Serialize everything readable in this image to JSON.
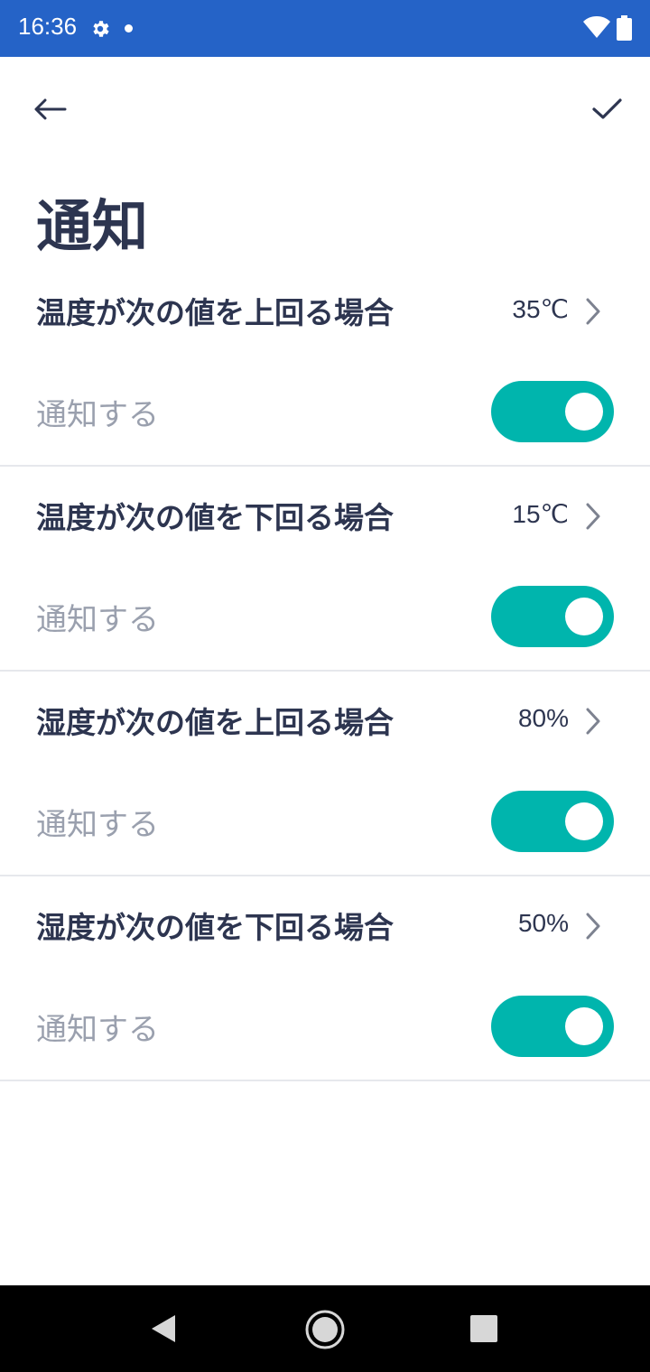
{
  "status_bar": {
    "time": "16:36",
    "icons": [
      "gear-icon",
      "dot-icon",
      "wifi-icon",
      "battery-icon"
    ]
  },
  "app_bar": {
    "back_icon": "arrow-left-icon",
    "save_icon": "check-icon"
  },
  "title": "通知",
  "settings": [
    {
      "label": "温度が次の値を上回る場合",
      "value": "35℃",
      "toggle_label": "通知する",
      "enabled": true
    },
    {
      "label": "温度が次の値を下回る場合",
      "value": "15℃",
      "toggle_label": "通知する",
      "enabled": true
    },
    {
      "label": "湿度が次の値を上回る場合",
      "value": "80%",
      "toggle_label": "通知する",
      "enabled": true
    },
    {
      "label": "湿度が次の値を下回る場合",
      "value": "50%",
      "toggle_label": "通知する",
      "enabled": true
    }
  ],
  "nav_bar": {
    "icons": [
      "nav-back-icon",
      "nav-home-icon",
      "nav-recents-icon"
    ]
  },
  "colors": {
    "status_bar": "#2563c7",
    "accent": "#00b5ad",
    "text_primary": "#2d3550",
    "text_secondary": "#9aa0ae"
  }
}
